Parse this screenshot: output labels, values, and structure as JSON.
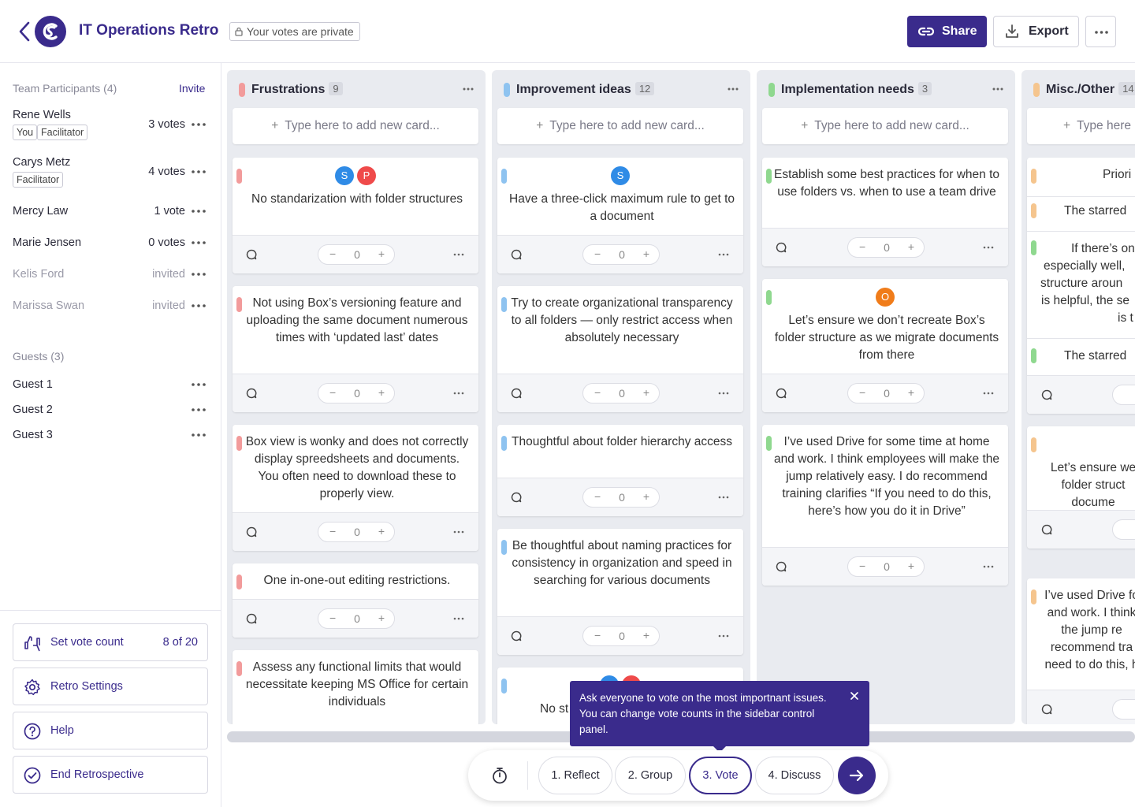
{
  "header": {
    "title": "IT Operations Retro",
    "privacy_badge": "Your votes are private",
    "share_label": "Share",
    "export_label": "Export"
  },
  "sidebar": {
    "participants_label": "Team Participants (4)",
    "invite_label": "Invite",
    "participants": [
      {
        "name": "Rene Wells",
        "votes": "3 votes",
        "tags": [
          "You",
          "Facilitator"
        ]
      },
      {
        "name": "Carys Metz",
        "votes": "4 votes",
        "tags": [
          "Facilitator"
        ]
      },
      {
        "name": "Mercy Law",
        "votes": "1 vote"
      },
      {
        "name": "Marie Jensen",
        "votes": "0 votes"
      },
      {
        "name": "Kelis Ford",
        "votes": "invited"
      },
      {
        "name": "Marissa Swan",
        "votes": "invited"
      }
    ],
    "guests_label": "Guests (3)",
    "guests": [
      "Guest 1",
      "Guest 2",
      "Guest 3"
    ],
    "vote_count_label": "Set vote count",
    "vote_count_value": "8 of 20",
    "settings_label": "Retro Settings",
    "help_label": "Help",
    "end_label": "End Retrospective"
  },
  "columns": [
    {
      "title": "Frustrations",
      "count": "9",
      "color": "#f29b9b",
      "add_placeholder": "Type here to add new card...",
      "cards": [
        {
          "text": "No standarization with folder structures",
          "votes": "0",
          "avatars": [
            {
              "letter": "S",
              "color": "#2f8be6"
            },
            {
              "letter": "P",
              "color": "#ef4a4a"
            }
          ]
        },
        {
          "text": "Not using Box’s versioning feature and uploading the same document numerous times with ‘updated last’ dates",
          "votes": "0"
        },
        {
          "text": "Box view is wonky and does not correctly display spreedsheets and documents. You often need to download these to properly view.",
          "votes": "0"
        },
        {
          "text": "One in-one-out editing restrictions.",
          "votes": "0"
        },
        {
          "text": "Assess any functional limits that would necessitate keeping MS Office for certain individuals",
          "votes": "0"
        }
      ]
    },
    {
      "title": "Improvement ideas",
      "count": "12",
      "color": "#8ec3f0",
      "add_placeholder": "Type here to add new card...",
      "cards": [
        {
          "text": "Have a three-click maximum rule to get to a document",
          "votes": "0",
          "avatars": [
            {
              "letter": "S",
              "color": "#2f8be6"
            }
          ]
        },
        {
          "text": "Try to create organizational transparency to all folders — only restrict access when absolutely necessary",
          "votes": "0"
        },
        {
          "text": "Thoughtful about folder hierarchy access",
          "votes": "0"
        },
        {
          "text": "Be thoughtful about naming practices for consistency in organization and speed in searching for various documents",
          "votes": "0"
        },
        {
          "text": "No st",
          "votes": "0"
        }
      ]
    },
    {
      "title": "Implementation needs",
      "count": "3",
      "color": "#8fd88f",
      "add_placeholder": "Type here to add new card...",
      "cards": [
        {
          "text": "Establish some best practices for when to use folders vs. when to use a team drive",
          "votes": "0"
        },
        {
          "text": "Let’s ensure we don’t recreate Box’s folder structure as we migrate documents from there",
          "votes": "0",
          "avatars": [
            {
              "letter": "O",
              "color": "#f07c1a"
            }
          ]
        },
        {
          "text": "I’ve used Drive for some time at home and work. I think employees will make the jump relatively easy. I do recommend training clarifies “If you need to do this, here’s how you do it in Drive”",
          "votes": "0"
        }
      ]
    },
    {
      "title": "Misc./Other",
      "count": "14",
      "color": "#f5c58e",
      "add_placeholder": "Type here",
      "cards": [
        {
          "lines": [
            "Priori",
            "The starred",
            "If there’s one",
            "especially well,",
            "structure aroun",
            "is helpful, the se",
            "is t",
            "The starred"
          ]
        },
        {
          "text": "Let’s ensure we folder struct docume"
        },
        {
          "text": "I’ve used Drive fo and work. I think the jump re recommend tra need to do this, h"
        }
      ]
    }
  ],
  "steps": [
    "1. Reflect",
    "2. Group",
    "3. Vote",
    "4. Discuss"
  ],
  "active_step": "3. Vote",
  "tooltip": "Ask everyone to vote on the most importnant issues. You can change vote counts in the sidebar control panel."
}
